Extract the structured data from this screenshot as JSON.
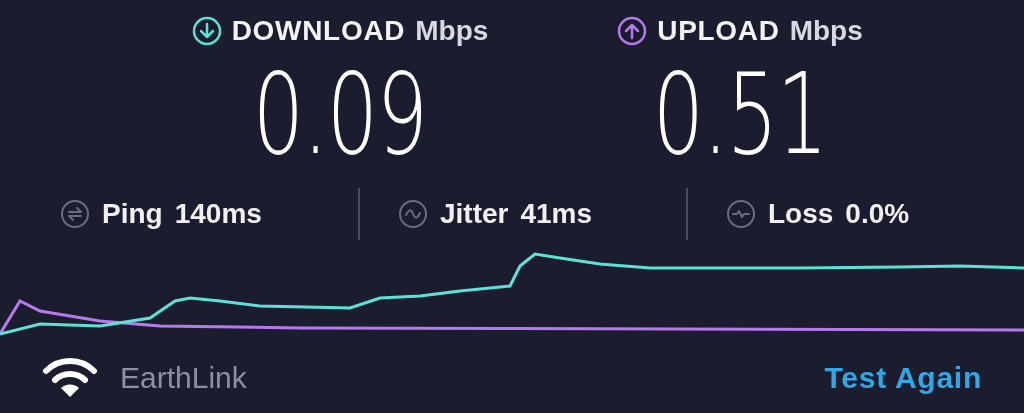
{
  "speeds": [
    {
      "kind": "download",
      "label": "DOWNLOAD",
      "unit": "Mbps",
      "value": "0.09",
      "color": "#5ce1d7"
    },
    {
      "kind": "upload",
      "label": "UPLOAD",
      "unit": "Mbps",
      "value": "0.51",
      "color": "#b57bec"
    }
  ],
  "stats": [
    {
      "kind": "ping",
      "label": "Ping",
      "value": "140ms"
    },
    {
      "kind": "jitter",
      "label": "Jitter",
      "value": "41ms"
    },
    {
      "kind": "loss",
      "label": "Loss",
      "value": "0.0%"
    }
  ],
  "provider": "EarthLink",
  "action": "Test Again"
}
